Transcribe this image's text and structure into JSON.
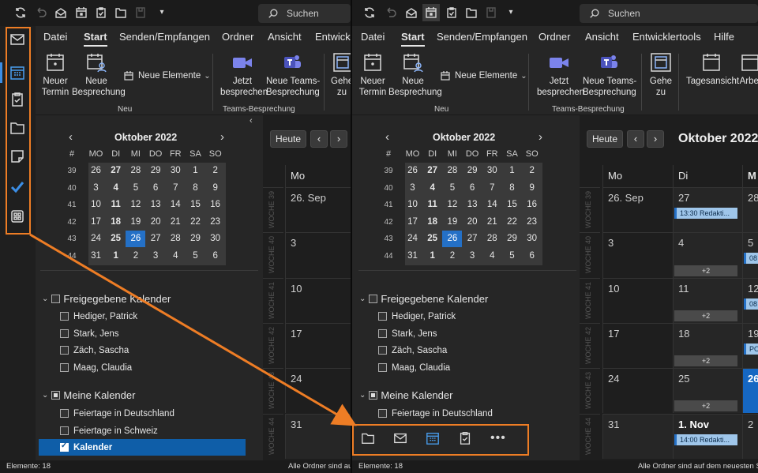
{
  "left": {
    "search_placeholder": "Suchen",
    "menu": [
      "Datei",
      "Start",
      "Senden/Empfangen",
      "Ordner",
      "Ansicht",
      "Entwickl"
    ],
    "ribbon": {
      "btn_new_appt": "Neuer\nTermin",
      "btn_new_meeting": "Neue\nBesprechung",
      "btn_new_items": "Neue Elemente",
      "btn_meet_now": "Jetzt\nbesprechen",
      "btn_teams_meeting": "Neue Teams-\nBesprechung",
      "btn_goto": "Gehe\nzu",
      "group_new": "Neu",
      "group_teams": "Teams-Besprechung"
    },
    "mini_cal": {
      "title": "Oktober 2022",
      "weekday_hash": "#",
      "weekdays": [
        "MO",
        "DI",
        "MI",
        "DO",
        "FR",
        "SA",
        "SO"
      ],
      "weeks": [
        "39",
        "40",
        "41",
        "42",
        "43",
        "44"
      ],
      "rows": [
        [
          "26",
          "27",
          "28",
          "29",
          "30",
          "1",
          "2"
        ],
        [
          "3",
          "4",
          "5",
          "6",
          "7",
          "8",
          "9"
        ],
        [
          "10",
          "11",
          "12",
          "13",
          "14",
          "15",
          "16"
        ],
        [
          "17",
          "18",
          "19",
          "20",
          "21",
          "22",
          "23"
        ],
        [
          "24",
          "25",
          "26",
          "27",
          "28",
          "29",
          "30"
        ],
        [
          "31",
          "1",
          "2",
          "3",
          "4",
          "5",
          "6"
        ]
      ]
    },
    "shared_group": "Freigegebene Kalender",
    "shared": [
      "Hediger, Patrick",
      "Stark, Jens",
      "Zäch, Sascha",
      "Maag, Claudia"
    ],
    "my_group": "Meine Kalender",
    "mine": [
      "Feiertage in Deutschland",
      "Feiertage in Schweiz",
      "Kalender"
    ],
    "today_btn": "Heute",
    "day_header": "Mo",
    "week_labels": [
      "WOCHE 39",
      "WOCHE 40",
      "WOCHE 41",
      "WOCHE 42",
      "WOCHE 43",
      "WOCHE 44"
    ],
    "day_nums": [
      "26. Sep",
      "3",
      "10",
      "17",
      "24",
      "31"
    ],
    "status_left": "Elemente: 18",
    "status_right": "Alle Ordner sind au"
  },
  "right": {
    "search_placeholder": "Suchen",
    "menu": [
      "Datei",
      "Start",
      "Senden/Empfangen",
      "Ordner",
      "Ansicht",
      "Entwicklertools",
      "Hilfe"
    ],
    "ribbon": {
      "btn_new_appt": "Neuer\nTermin",
      "btn_new_meeting": "Neue\nBesprechung",
      "btn_new_items": "Neue Elemente",
      "btn_meet_now": "Jetzt\nbesprechen",
      "btn_teams_meeting": "Neue Teams-\nBesprechung",
      "btn_goto": "Gehe\nzu",
      "btn_day_view": "Tagesansicht",
      "btn_work": "Arbei",
      "group_new": "Neu",
      "group_teams": "Teams-Besprechung"
    },
    "mini_cal": {
      "title": "Oktober 2022",
      "weekday_hash": "#",
      "weekdays": [
        "MO",
        "DI",
        "MI",
        "DO",
        "FR",
        "SA",
        "SO"
      ],
      "weeks": [
        "39",
        "40",
        "41",
        "42",
        "43",
        "44"
      ],
      "rows": [
        [
          "26",
          "27",
          "28",
          "29",
          "30",
          "1",
          "2"
        ],
        [
          "3",
          "4",
          "5",
          "6",
          "7",
          "8",
          "9"
        ],
        [
          "10",
          "11",
          "12",
          "13",
          "14",
          "15",
          "16"
        ],
        [
          "17",
          "18",
          "19",
          "20",
          "21",
          "22",
          "23"
        ],
        [
          "24",
          "25",
          "26",
          "27",
          "28",
          "29",
          "30"
        ],
        [
          "31",
          "1",
          "2",
          "3",
          "4",
          "5",
          "6"
        ]
      ]
    },
    "shared_group": "Freigegebene Kalender",
    "shared": [
      "Hediger, Patrick",
      "Stark, Jens",
      "Zäch, Sascha",
      "Maag, Claudia"
    ],
    "my_group": "Meine Kalender",
    "mine": [
      "Feiertage in Deutschland"
    ],
    "today_btn": "Heute",
    "month_title": "Oktober 2022",
    "day_headers": [
      "Mo",
      "Di",
      "M"
    ],
    "week_labels": [
      "WOCHE 39",
      "WOCHE 40",
      "WOCHE 41",
      "WOCHE 42",
      "WOCHE 43",
      "WOCHE 44"
    ],
    "col_mo": [
      "26. Sep",
      "3",
      "10",
      "17",
      "24",
      "31"
    ],
    "col_di": [
      "27",
      "4",
      "11",
      "18",
      "25",
      "1. Nov"
    ],
    "col_mi": [
      "28",
      "5",
      "12",
      "19",
      "26",
      "2"
    ],
    "events": {
      "e1": "13:30 Redakti...",
      "e2": "14:00 Redakti...",
      "e3": "08",
      "e4": "08",
      "e5": "PO"
    },
    "more": "+2",
    "status_left": "Elemente: 18",
    "status_right": "Alle Ordner sind auf dem neuesten S"
  },
  "colors": {
    "accent": "#2470c6",
    "callout": "#ee7d25",
    "event_bg": "#9fc6ea"
  }
}
